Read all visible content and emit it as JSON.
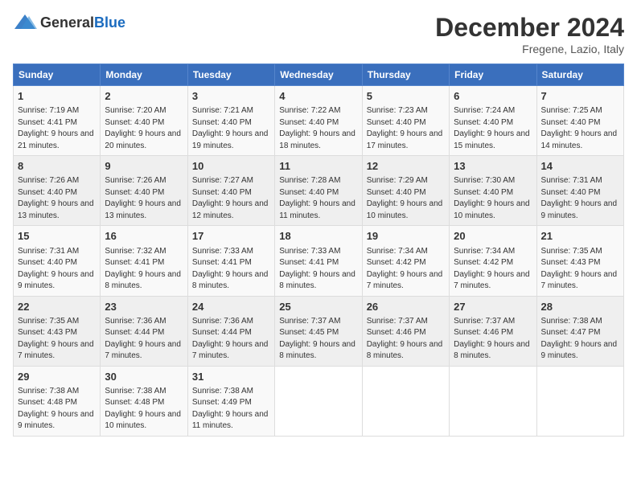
{
  "logo": {
    "general": "General",
    "blue": "Blue"
  },
  "title": "December 2024",
  "subtitle": "Fregene, Lazio, Italy",
  "weekdays": [
    "Sunday",
    "Monday",
    "Tuesday",
    "Wednesday",
    "Thursday",
    "Friday",
    "Saturday"
  ],
  "weeks": [
    [
      {
        "day": "1",
        "info": "Sunrise: 7:19 AM\nSunset: 4:41 PM\nDaylight: 9 hours and 21 minutes."
      },
      {
        "day": "2",
        "info": "Sunrise: 7:20 AM\nSunset: 4:40 PM\nDaylight: 9 hours and 20 minutes."
      },
      {
        "day": "3",
        "info": "Sunrise: 7:21 AM\nSunset: 4:40 PM\nDaylight: 9 hours and 19 minutes."
      },
      {
        "day": "4",
        "info": "Sunrise: 7:22 AM\nSunset: 4:40 PM\nDaylight: 9 hours and 18 minutes."
      },
      {
        "day": "5",
        "info": "Sunrise: 7:23 AM\nSunset: 4:40 PM\nDaylight: 9 hours and 17 minutes."
      },
      {
        "day": "6",
        "info": "Sunrise: 7:24 AM\nSunset: 4:40 PM\nDaylight: 9 hours and 15 minutes."
      },
      {
        "day": "7",
        "info": "Sunrise: 7:25 AM\nSunset: 4:40 PM\nDaylight: 9 hours and 14 minutes."
      }
    ],
    [
      {
        "day": "8",
        "info": "Sunrise: 7:26 AM\nSunset: 4:40 PM\nDaylight: 9 hours and 13 minutes."
      },
      {
        "day": "9",
        "info": "Sunrise: 7:26 AM\nSunset: 4:40 PM\nDaylight: 9 hours and 13 minutes."
      },
      {
        "day": "10",
        "info": "Sunrise: 7:27 AM\nSunset: 4:40 PM\nDaylight: 9 hours and 12 minutes."
      },
      {
        "day": "11",
        "info": "Sunrise: 7:28 AM\nSunset: 4:40 PM\nDaylight: 9 hours and 11 minutes."
      },
      {
        "day": "12",
        "info": "Sunrise: 7:29 AM\nSunset: 4:40 PM\nDaylight: 9 hours and 10 minutes."
      },
      {
        "day": "13",
        "info": "Sunrise: 7:30 AM\nSunset: 4:40 PM\nDaylight: 9 hours and 10 minutes."
      },
      {
        "day": "14",
        "info": "Sunrise: 7:31 AM\nSunset: 4:40 PM\nDaylight: 9 hours and 9 minutes."
      }
    ],
    [
      {
        "day": "15",
        "info": "Sunrise: 7:31 AM\nSunset: 4:40 PM\nDaylight: 9 hours and 9 minutes."
      },
      {
        "day": "16",
        "info": "Sunrise: 7:32 AM\nSunset: 4:41 PM\nDaylight: 9 hours and 8 minutes."
      },
      {
        "day": "17",
        "info": "Sunrise: 7:33 AM\nSunset: 4:41 PM\nDaylight: 9 hours and 8 minutes."
      },
      {
        "day": "18",
        "info": "Sunrise: 7:33 AM\nSunset: 4:41 PM\nDaylight: 9 hours and 8 minutes."
      },
      {
        "day": "19",
        "info": "Sunrise: 7:34 AM\nSunset: 4:42 PM\nDaylight: 9 hours and 7 minutes."
      },
      {
        "day": "20",
        "info": "Sunrise: 7:34 AM\nSunset: 4:42 PM\nDaylight: 9 hours and 7 minutes."
      },
      {
        "day": "21",
        "info": "Sunrise: 7:35 AM\nSunset: 4:43 PM\nDaylight: 9 hours and 7 minutes."
      }
    ],
    [
      {
        "day": "22",
        "info": "Sunrise: 7:35 AM\nSunset: 4:43 PM\nDaylight: 9 hours and 7 minutes."
      },
      {
        "day": "23",
        "info": "Sunrise: 7:36 AM\nSunset: 4:44 PM\nDaylight: 9 hours and 7 minutes."
      },
      {
        "day": "24",
        "info": "Sunrise: 7:36 AM\nSunset: 4:44 PM\nDaylight: 9 hours and 7 minutes."
      },
      {
        "day": "25",
        "info": "Sunrise: 7:37 AM\nSunset: 4:45 PM\nDaylight: 9 hours and 8 minutes."
      },
      {
        "day": "26",
        "info": "Sunrise: 7:37 AM\nSunset: 4:46 PM\nDaylight: 9 hours and 8 minutes."
      },
      {
        "day": "27",
        "info": "Sunrise: 7:37 AM\nSunset: 4:46 PM\nDaylight: 9 hours and 8 minutes."
      },
      {
        "day": "28",
        "info": "Sunrise: 7:38 AM\nSunset: 4:47 PM\nDaylight: 9 hours and 9 minutes."
      }
    ],
    [
      {
        "day": "29",
        "info": "Sunrise: 7:38 AM\nSunset: 4:48 PM\nDaylight: 9 hours and 9 minutes."
      },
      {
        "day": "30",
        "info": "Sunrise: 7:38 AM\nSunset: 4:48 PM\nDaylight: 9 hours and 10 minutes."
      },
      {
        "day": "31",
        "info": "Sunrise: 7:38 AM\nSunset: 4:49 PM\nDaylight: 9 hours and 11 minutes."
      },
      null,
      null,
      null,
      null
    ]
  ]
}
